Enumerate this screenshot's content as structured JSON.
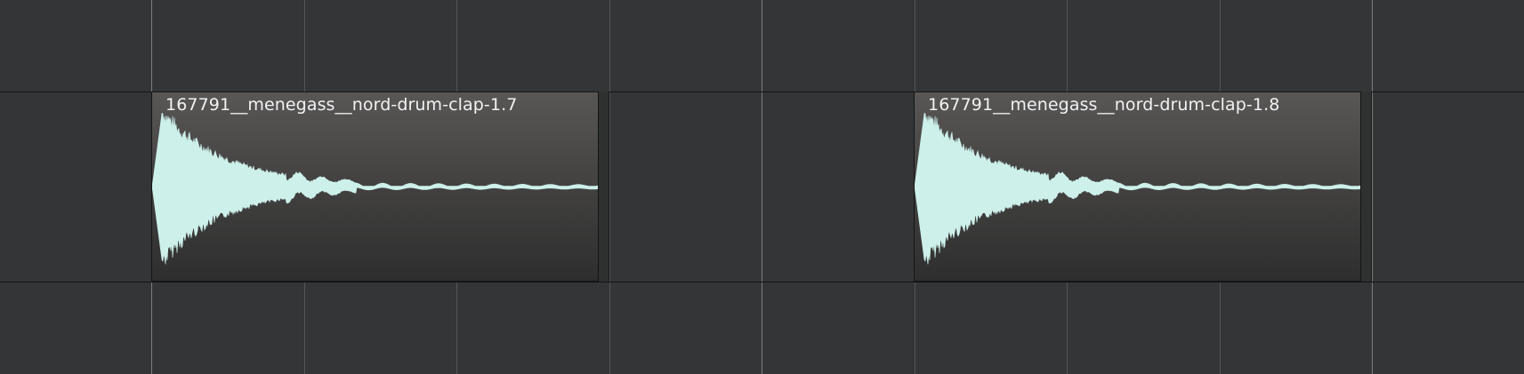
{
  "arrangement": {
    "background_color": "#343536",
    "clip_color": "#cdf0ea",
    "clips": [
      {
        "name": "167791__menegass__nord-drum-clap-1.7"
      },
      {
        "name": "167791__menegass__nord-drum-clap-1.8"
      }
    ]
  }
}
